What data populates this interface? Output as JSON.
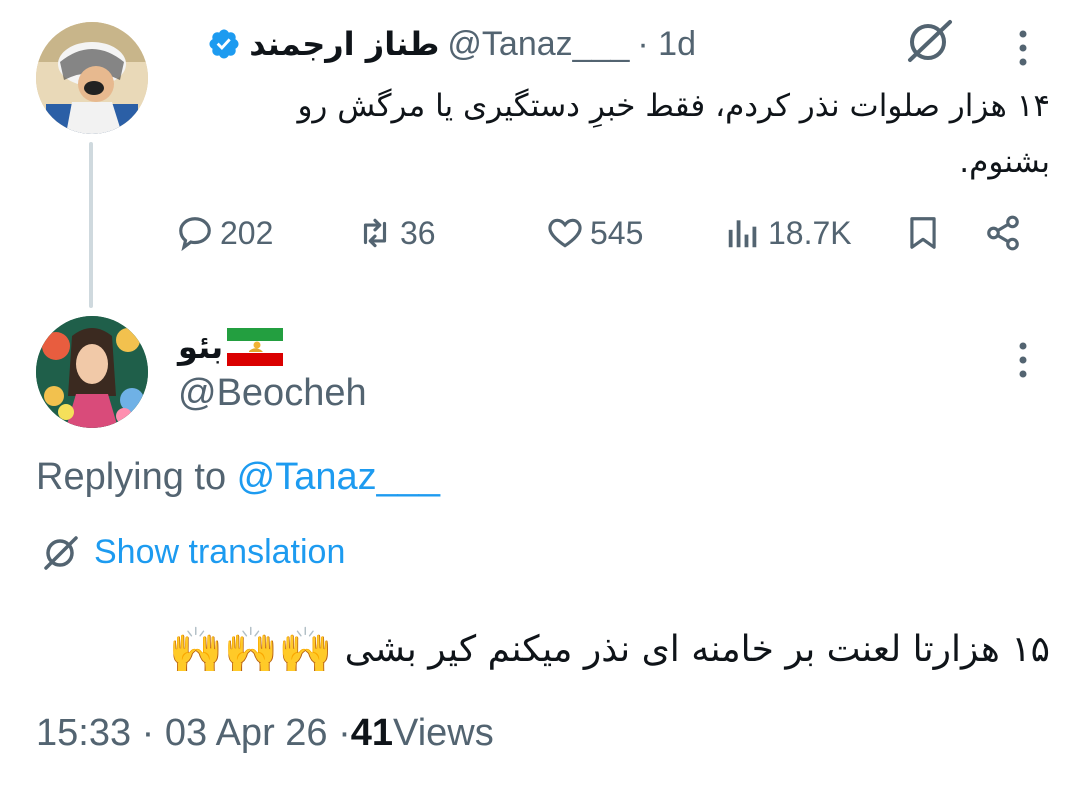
{
  "parent_tweet": {
    "display_name": "طناز ارجمند",
    "handle": "@Tanaz___",
    "time": "· 1d",
    "text_line1": "۱۴ هزار صلوات نذر کردم، فقط خبرِ دستگیری یا مرگش رو",
    "text_line2": "بشنوم.",
    "replies": "202",
    "reposts": "36",
    "likes": "545",
    "views": "18.7K"
  },
  "reply_tweet": {
    "display_name": "بئو",
    "handle": "@Beocheh",
    "replying_prefix": "Replying to ",
    "replying_to": "@Tanaz___",
    "show_translation": "Show translation",
    "text": "۱۵ هزارتا لعنت بر خامنه ای نذر میکنم کیر بشی",
    "emoji": "🙌🙌🙌",
    "time": "15:33 · 03 Apr 26 · ",
    "views_count": "41",
    "views_label": " Views"
  },
  "colors": {
    "accent": "#1d9bf0",
    "secondary_text": "#536471",
    "primary_text": "#0f1419",
    "thread_line": "#cfd9de"
  },
  "icons": [
    "verified-badge-icon",
    "grok-icon",
    "more-icon",
    "reply-icon",
    "repost-icon",
    "like-icon",
    "views-icon",
    "bookmark-icon",
    "share-icon",
    "translate-icon",
    "iran-lion-sun-flag-icon"
  ]
}
